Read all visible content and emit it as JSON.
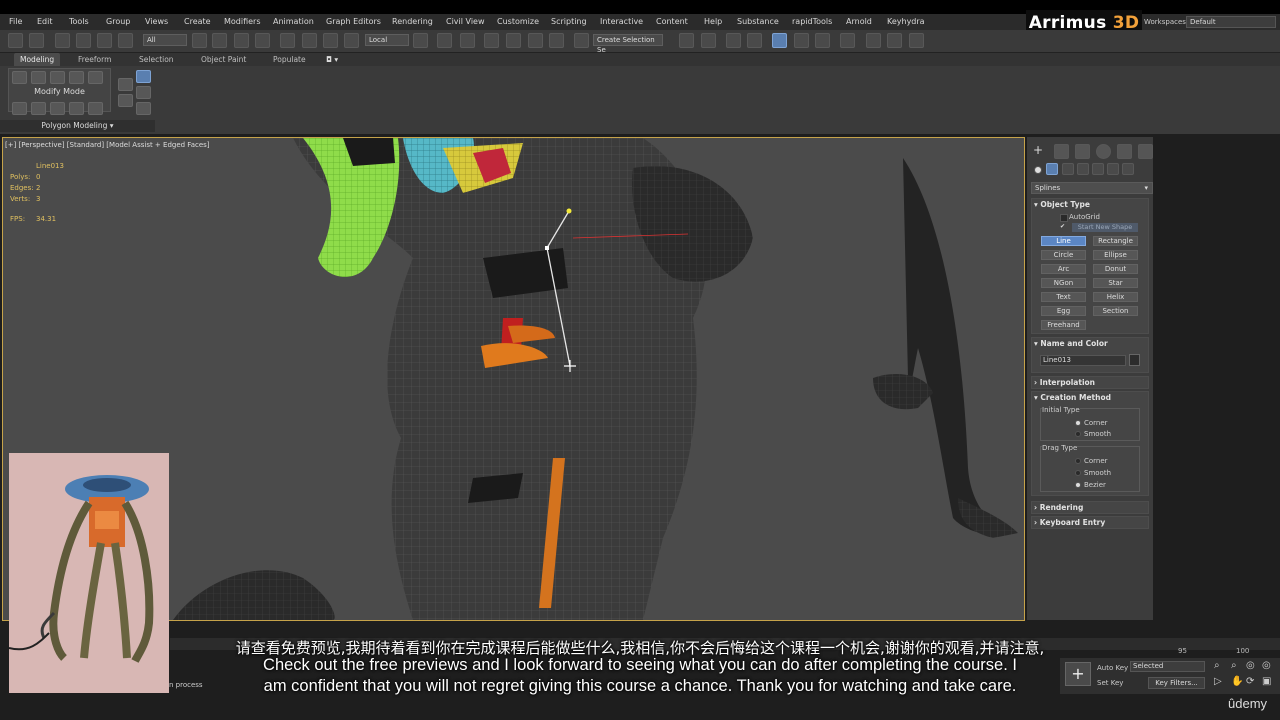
{
  "menu": [
    "File",
    "Edit",
    "Tools",
    "Group",
    "Views",
    "Create",
    "Modifiers",
    "Animation",
    "Graph Editors",
    "Rendering",
    "Civil View",
    "Customize",
    "Scripting",
    "Interactive",
    "Content",
    "Help",
    "Substance",
    "rapidTools",
    "Arnold",
    "Keyhydra"
  ],
  "brand": {
    "name": "Arrimus",
    "suffix": "3D"
  },
  "workspaces": {
    "label": "Workspaces:",
    "value": "Default"
  },
  "toolbar": {
    "filter": "All",
    "coord": "Local",
    "selection_set": "Create Selection Se"
  },
  "ribbon": {
    "tabs": [
      "Modeling",
      "Freeform",
      "Selection",
      "Object Paint",
      "Populate"
    ],
    "mode": "Modify Mode",
    "panel": "Polygon Modeling"
  },
  "viewport": {
    "label": "[+] [Perspective] [Standard] [Model Assist + Edged Faces]",
    "stats": {
      "object": "Line013",
      "polys_label": "Polys:",
      "polys": "0",
      "edges_label": "Edges:",
      "edges": "2",
      "verts_label": "Verts:",
      "verts": "3",
      "fps_label": "FPS:",
      "fps": "34.31"
    }
  },
  "command_panel": {
    "category": "Splines",
    "object_type": {
      "title": "Object Type",
      "autogrid": "AutoGrid",
      "start_new_shape": "Start New Shape",
      "buttons": [
        "Line",
        "Rectangle",
        "Circle",
        "Ellipse",
        "Arc",
        "Donut",
        "NGon",
        "Star",
        "Text",
        "Helix",
        "Egg",
        "Section",
        "Freehand"
      ]
    },
    "name_color": {
      "title": "Name and Color",
      "name": "Line013"
    },
    "interpolation": "Interpolation",
    "creation_method": {
      "title": "Creation Method",
      "initial_type": "Initial Type",
      "initial_options": [
        "Corner",
        "Smooth"
      ],
      "drag_type": "Drag Type",
      "drag_options": [
        "Corner",
        "Smooth",
        "Bezier"
      ]
    },
    "rendering": "Rendering",
    "keyboard_entry": "Keyboard Entry"
  },
  "timeline": {
    "ticks": [
      "95",
      "100"
    ]
  },
  "bottom": {
    "auto_key": "Auto Key",
    "selected": "Selected",
    "set_key": "Set Key",
    "key_filters": "Key Filters..."
  },
  "status": {
    "text": "n process"
  },
  "subtitles": {
    "cn": "请查看免费预览,我期待着看到你在完成课程后能做些什么,我相信,你不会后悔给这个课程一个机会,谢谢你的观看,并请注意,",
    "en1": "Check out the free previews and I look forward to seeing what you can do after completing the course. I",
    "en2": "am confident that you will not regret giving this course a chance. Thank you for watching and take care."
  },
  "watermark": "ûdemy"
}
